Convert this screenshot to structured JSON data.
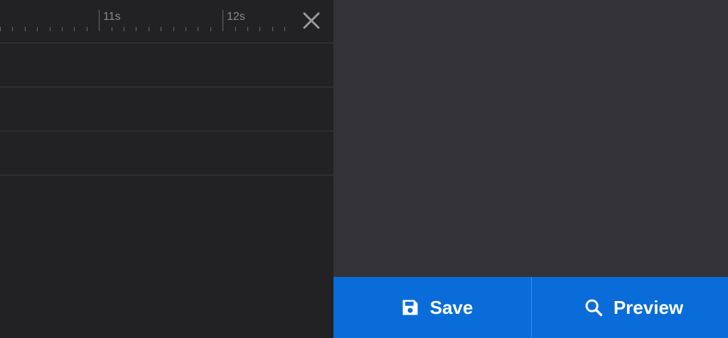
{
  "ruler": {
    "labels": [
      "11s",
      "12s"
    ]
  },
  "actions": {
    "save_label": "Save",
    "preview_label": "Preview"
  },
  "icons": {
    "close": "close-icon",
    "save": "floppy-disk-icon",
    "preview": "magnifier-icon"
  },
  "colors": {
    "timeline_bg": "#222225",
    "preview_bg": "#333337",
    "action_bar_bg": "#0a6cd8",
    "text_on_accent": "#ffffff"
  }
}
